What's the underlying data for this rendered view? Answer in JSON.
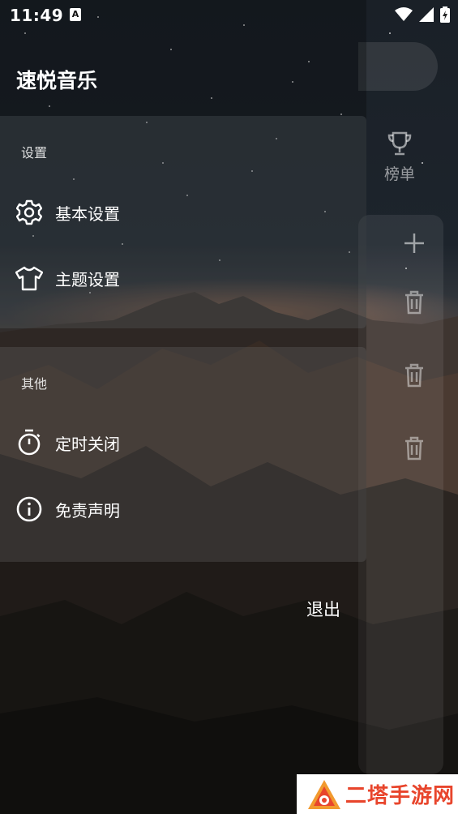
{
  "status_bar": {
    "time": "11:49",
    "notification_badge": "A",
    "icons": [
      "wifi-icon",
      "signal-icon",
      "battery-charging-icon"
    ]
  },
  "drawer": {
    "app_title": "速悦音乐",
    "sections": [
      {
        "header": "设置",
        "items": [
          {
            "label": "基本设置",
            "icon": "gear-icon"
          },
          {
            "label": "主题设置",
            "icon": "tshirt-icon"
          }
        ]
      },
      {
        "header": "其他",
        "items": [
          {
            "label": "定时关闭",
            "icon": "timer-icon"
          },
          {
            "label": "免责声明",
            "icon": "info-icon"
          }
        ]
      }
    ],
    "exit_label": "退出"
  },
  "main_page": {
    "rank_tab_label": "榜单",
    "icons": [
      "trophy-icon",
      "plus-icon",
      "trash-icon"
    ]
  },
  "watermark": {
    "text": "二塔手游网"
  },
  "colors": {
    "text": "#ffffff",
    "watermark_text": "#e8452c",
    "card_bg": "rgba(120,128,136,0.20)"
  }
}
